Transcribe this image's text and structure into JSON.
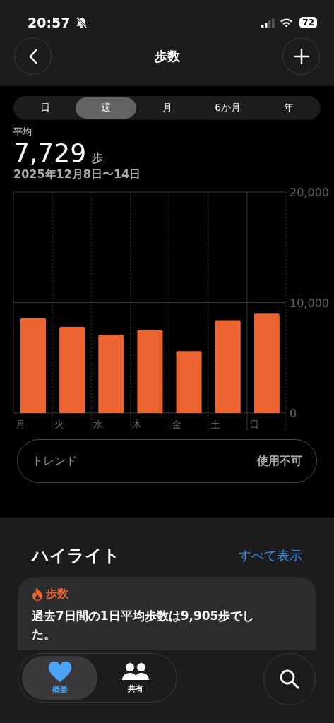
{
  "status_bar": {
    "time": "20:57",
    "battery": "72"
  },
  "nav": {
    "title": "歩数"
  },
  "periods": [
    {
      "label": "日",
      "selected": false
    },
    {
      "label": "週",
      "selected": true
    },
    {
      "label": "月",
      "selected": false
    },
    {
      "label": "6か月",
      "selected": false
    },
    {
      "label": "年",
      "selected": false
    }
  ],
  "summary": {
    "label": "平均",
    "value": "7,729",
    "unit": "歩",
    "range": "2025年12月8日〜14日"
  },
  "chart_data": {
    "type": "bar",
    "categories": [
      "月",
      "火",
      "水",
      "木",
      "金",
      "土",
      "日"
    ],
    "series": [
      {
        "color": "#eb6432",
        "values": [
          8600,
          7800,
          7100,
          7500,
          5600,
          8400,
          9000
        ]
      }
    ],
    "ylim": [
      0,
      20000
    ],
    "yticks": [
      {
        "value": 0,
        "label": "0"
      },
      {
        "value": 10000,
        "label": "10,000"
      },
      {
        "value": 20000,
        "label": "20,000"
      }
    ]
  },
  "trend": {
    "label": "トレンド",
    "value": "使用不可"
  },
  "highlights": {
    "title": "ハイライト",
    "link": "すべて表示",
    "card": {
      "category": "歩数",
      "text": "過去7日間の1日平均歩数は9,905歩でした。"
    }
  },
  "tab_bar": [
    {
      "label": "概要",
      "kind": "heart",
      "selected": true
    },
    {
      "label": "共有",
      "kind": "people",
      "selected": false
    }
  ]
}
